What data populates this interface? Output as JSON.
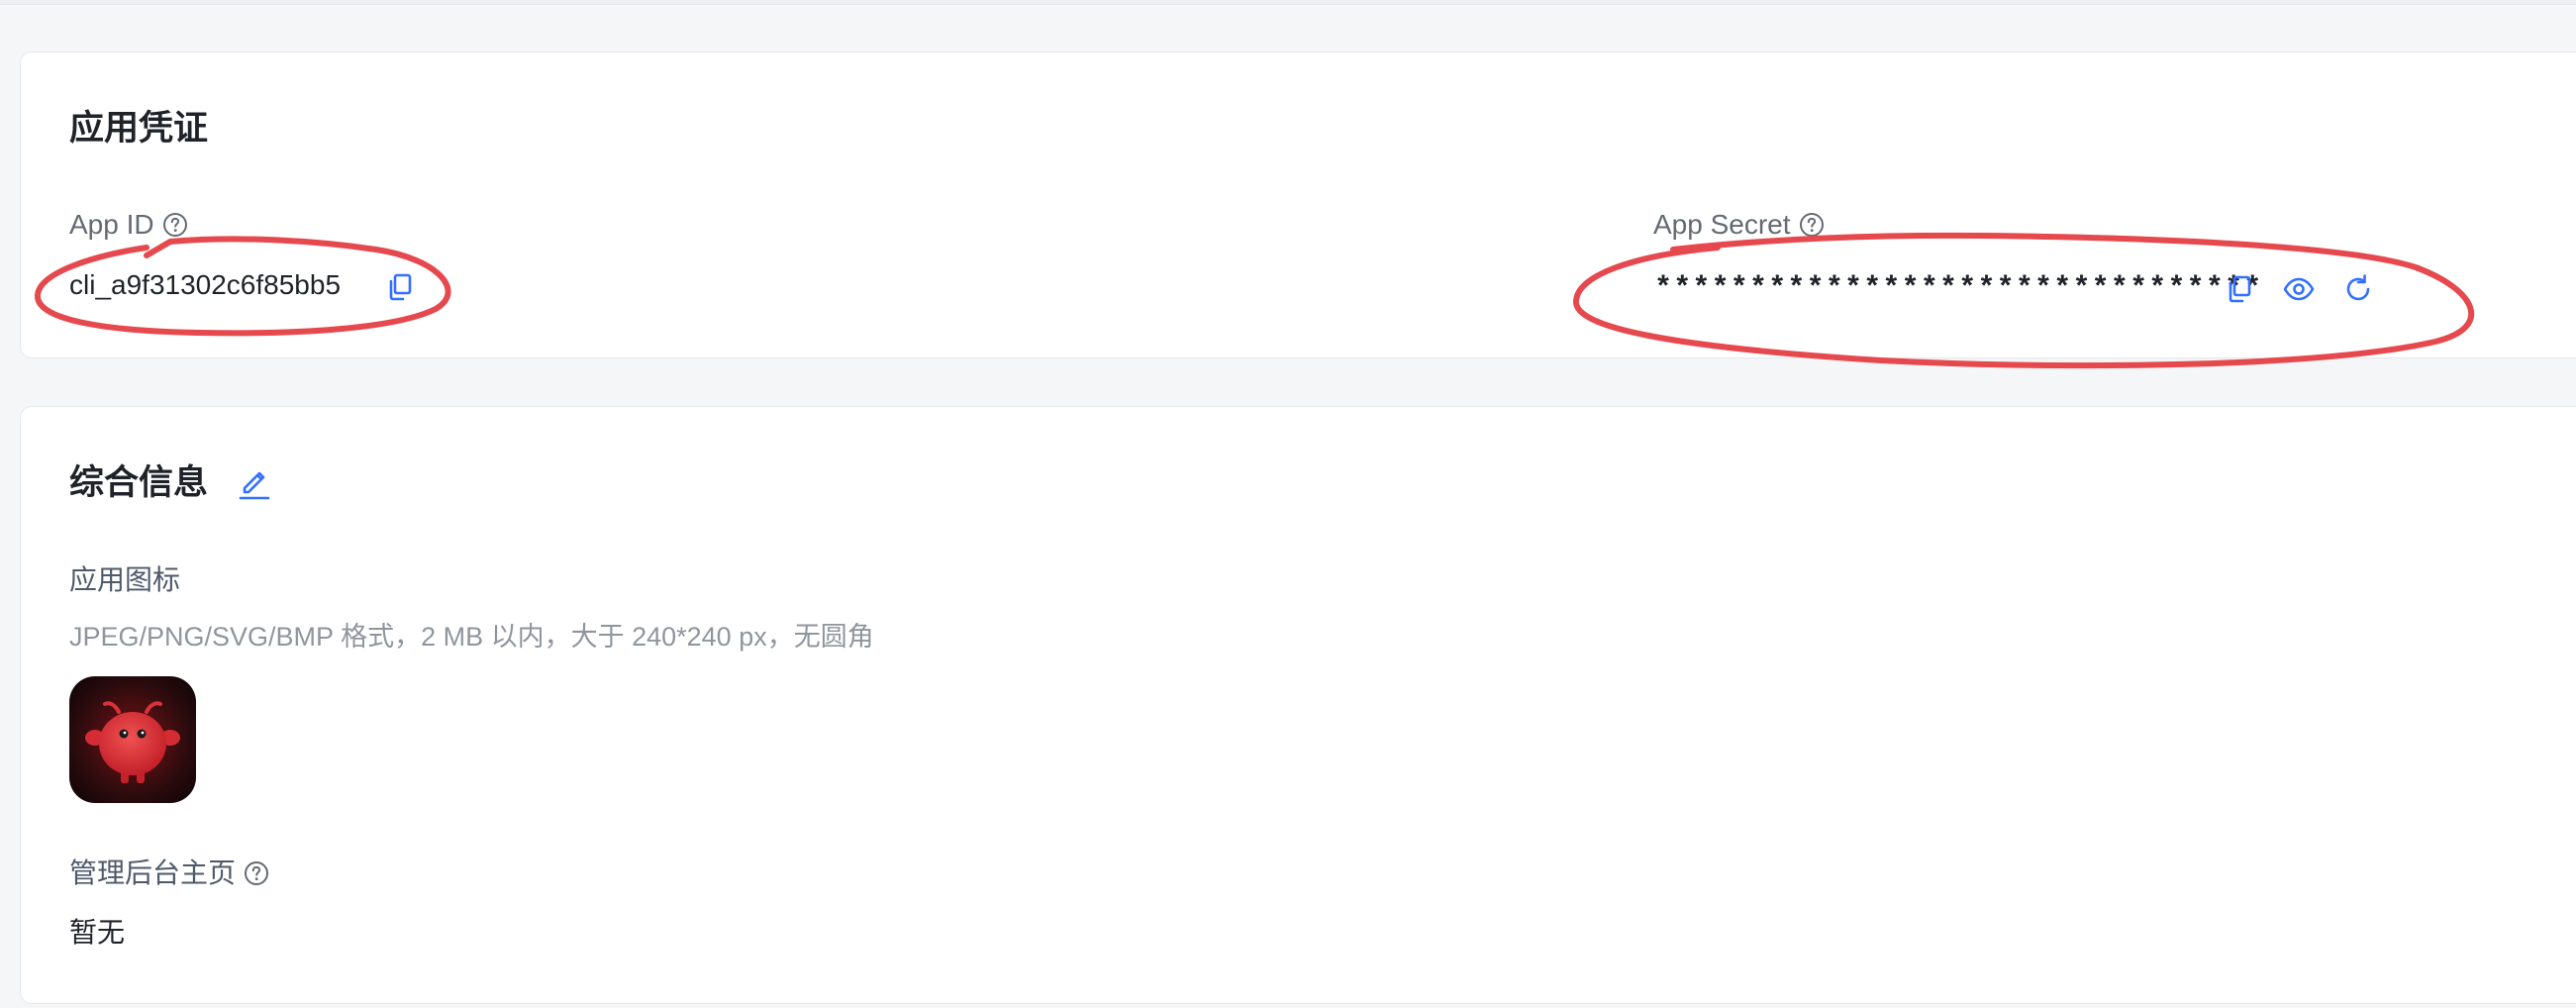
{
  "credentials": {
    "title": "应用凭证",
    "app_id": {
      "label": "App ID",
      "value": "cli_a9f31302c6f85bb5"
    },
    "app_secret": {
      "label": "App Secret",
      "value": "********************************"
    }
  },
  "info": {
    "title": "综合信息",
    "app_icon": {
      "label": "应用图标",
      "hint": "JPEG/PNG/SVG/BMP 格式，2 MB 以内，大于 240*240 px，无圆角"
    },
    "admin_home": {
      "label": "管理后台主页",
      "value": "暂无"
    }
  },
  "icons": {
    "help": "help-circle-icon",
    "copy": "copy-icon",
    "view": "eye-icon",
    "refresh": "refresh-icon",
    "edit": "pencil-edit-icon",
    "app": "red-mascot-app-icon"
  },
  "colors": {
    "accent": "#3370ff",
    "annotation": "#e5484d",
    "muted": "#8f959e",
    "label": "#646a73"
  }
}
